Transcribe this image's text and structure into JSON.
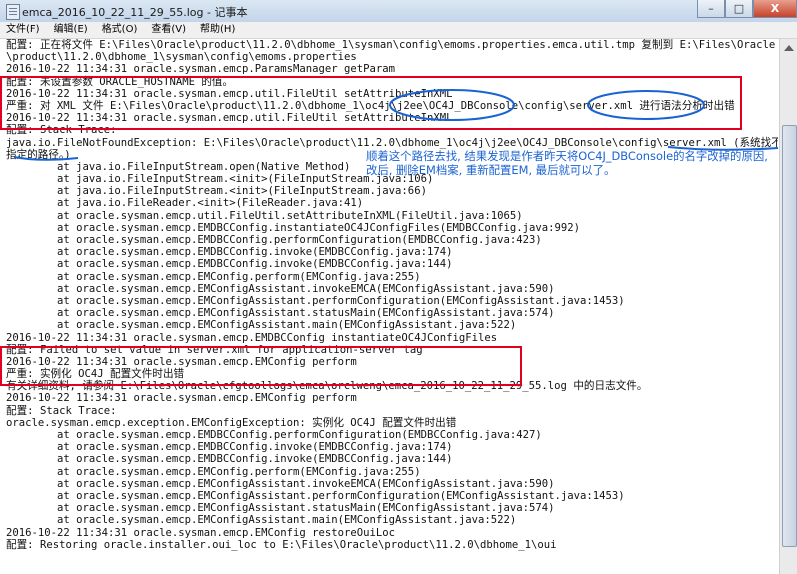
{
  "window": {
    "title": "emca_2016_10_22_11_29_55.log - 记事本",
    "min_label": "–",
    "max_label": "□",
    "close_label": "X"
  },
  "menu": [
    "文件(F)",
    "编辑(E)",
    "格式(O)",
    "查看(V)",
    "帮助(H)"
  ],
  "lines": [
    "配置: 正在将文件 E:\\Files\\Oracle\\product\\11.2.0\\dbhome_1\\sysman\\config\\emoms.properties.emca.util.tmp 复制到 E:\\Files\\Oracle",
    "\\product\\11.2.0\\dbhome_1\\sysman\\config\\emoms.properties",
    "2016-10-22 11:34:31 oracle.sysman.emcp.ParamsManager getParam",
    "配置: 未设置参数 ORACLE_HOSTNAME 的值。",
    "2016-10-22 11:34:31 oracle.sysman.emcp.util.FileUtil setAttributeInXML",
    "严重: 对 XML 文件 E:\\Files\\Oracle\\product\\11.2.0\\dbhome_1\\oc4j\\j2ee\\OC4J_DBConsole\\config\\server.xml 进行语法分析时出错",
    "2016-10-22 11:34:31 oracle.sysman.emcp.util.FileUtil setAttributeInXML",
    "配置: Stack Trace:",
    "java.io.FileNotFoundException: E:\\Files\\Oracle\\product\\11.2.0\\dbhome_1\\oc4j\\j2ee\\OC4J_DBConsole\\config\\server.xml (系统找不到",
    "指定的路径。)",
    "        at java.io.FileInputStream.open(Native Method)",
    "        at java.io.FileInputStream.<init>(FileInputStream.java:106)",
    "        at java.io.FileInputStream.<init>(FileInputStream.java:66)",
    "        at java.io.FileReader.<init>(FileReader.java:41)",
    "        at oracle.sysman.emcp.util.FileUtil.setAttributeInXML(FileUtil.java:1065)",
    "        at oracle.sysman.emcp.EMDBCConfig.instantiateOC4JConfigFiles(EMDBCConfig.java:992)",
    "        at oracle.sysman.emcp.EMDBCConfig.performConfiguration(EMDBCConfig.java:423)",
    "        at oracle.sysman.emcp.EMDBCConfig.invoke(EMDBCConfig.java:174)",
    "        at oracle.sysman.emcp.EMDBCConfig.invoke(EMDBCConfig.java:144)",
    "        at oracle.sysman.emcp.EMConfig.perform(EMConfig.java:255)",
    "        at oracle.sysman.emcp.EMConfigAssistant.invokeEMCA(EMConfigAssistant.java:590)",
    "        at oracle.sysman.emcp.EMConfigAssistant.performConfiguration(EMConfigAssistant.java:1453)",
    "        at oracle.sysman.emcp.EMConfigAssistant.statusMain(EMConfigAssistant.java:574)",
    "        at oracle.sysman.emcp.EMConfigAssistant.main(EMConfigAssistant.java:522)",
    "2016-10-22 11:34:31 oracle.sysman.emcp.EMDBCConfig instantiateOC4JConfigFiles",
    "配置: Failed to set value in server.xml for application-server tag",
    "2016-10-22 11:34:31 oracle.sysman.emcp.EMConfig perform",
    "严重: 实例化 OC4J 配置文件时出错",
    "有关详细资料, 请参阅 E:\\Files\\Oracle\\cfgtoollogs\\emca\\orclweng\\emca_2016_10_22_11_29_55.log 中的日志文件。",
    "2016-10-22 11:34:31 oracle.sysman.emcp.EMConfig perform",
    "配置: Stack Trace:",
    "oracle.sysman.emcp.exception.EMConfigException: 实例化 OC4J 配置文件时出错",
    "        at oracle.sysman.emcp.EMDBCConfig.performConfiguration(EMDBCConfig.java:427)",
    "        at oracle.sysman.emcp.EMDBCConfig.invoke(EMDBCConfig.java:174)",
    "        at oracle.sysman.emcp.EMDBCConfig.invoke(EMDBCConfig.java:144)",
    "        at oracle.sysman.emcp.EMConfig.perform(EMConfig.java:255)",
    "        at oracle.sysman.emcp.EMConfigAssistant.invokeEMCA(EMConfigAssistant.java:590)",
    "        at oracle.sysman.emcp.EMConfigAssistant.performConfiguration(EMConfigAssistant.java:1453)",
    "        at oracle.sysman.emcp.EMConfigAssistant.statusMain(EMConfigAssistant.java:574)",
    "        at oracle.sysman.emcp.EMConfigAssistant.main(EMConfigAssistant.java:522)",
    "2016-10-22 11:34:31 oracle.sysman.emcp.EMConfig restoreOuiLoc",
    "配置: Restoring oracle.installer.oui_loc to E:\\Files\\Oracle\\product\\11.2.0\\dbhome_1\\oui"
  ],
  "annotation_note": "顺着这个路径去找, 结果发现是作者昨天将OC4J_DBConsole的名字改掉的原因, 改后, 删除EM档案, 重新配置EM, 最后就可以了。",
  "colors": {
    "highlight_box": "#e00020",
    "annotation_ink": "#1a63d2"
  }
}
